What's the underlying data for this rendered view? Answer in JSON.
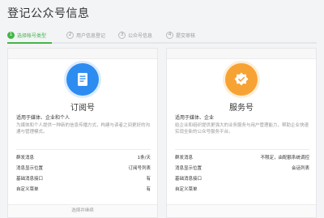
{
  "page": {
    "title": "登记公众号信息"
  },
  "steps": [
    {
      "num": "1",
      "label": "选择帐号类型"
    },
    {
      "num": "2",
      "label": "用户信息登记"
    },
    {
      "num": "3",
      "label": "公众号信息"
    },
    {
      "num": "4",
      "label": "提交审核"
    }
  ],
  "cards": {
    "subscription": {
      "title": "订阅号",
      "subtitle": "适用于媒体、企业和个人",
      "desc": "为媒体和个人提供一种新的信息传播方式，构建与读者之间更好的沟通与管理模式。",
      "features": [
        {
          "key": "群发消息",
          "value": "1条/天"
        },
        {
          "key": "消息显示位置",
          "value": "订阅号列表"
        },
        {
          "key": "基础消息接口",
          "value": "有"
        },
        {
          "key": "自定义菜单",
          "value": "有"
        }
      ],
      "button": "选择并继续"
    },
    "service": {
      "title": "服务号",
      "subtitle": "适用于媒体、企业",
      "desc": "给企业和组织提供更强大的业务服务与用户管理能力，帮助企业快速实现全新的公众号服务平台。",
      "features": [
        {
          "key": "群发消息",
          "value": "不限定，由配额系统调控"
        },
        {
          "key": "消息显示位置",
          "value": "会话列表"
        },
        {
          "key": "基础消息接口",
          "value": ""
        },
        {
          "key": "自定义菜单",
          "value": ""
        }
      ],
      "button": ""
    }
  },
  "colors": {
    "accent": "#44b549",
    "subscription_icon": "#2d8cf0",
    "service_icon": "#f7a334"
  }
}
